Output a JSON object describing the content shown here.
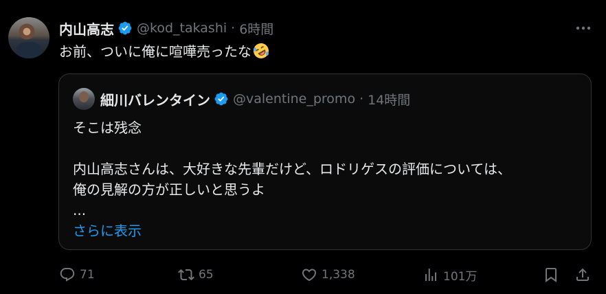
{
  "tweet": {
    "author_name": "内山高志",
    "handle": "@kod_takashi",
    "separator": "·",
    "time": "6時間",
    "text": "お前、ついに俺に喧嘩売ったな",
    "emoji": "rolling-on-floor-laughing-emoji"
  },
  "quote": {
    "author_name": "細川バレンタイン",
    "handle": "@valentine_promo",
    "separator": "·",
    "time": "14時間",
    "lines": [
      "そこは残念",
      "",
      "内山高志さんは、大好きな先輩だけど、ロドリゲスの評価については、",
      "俺の見解の方が正しいと思うよ",
      "..."
    ],
    "show_more": "さらに表示"
  },
  "actions": {
    "reply_count": "71",
    "retweet_count": "65",
    "like_count": "1,338",
    "views_count": "101万"
  },
  "colors": {
    "background": "#000000",
    "text": "#e7e9ea",
    "muted": "#71767b",
    "accent": "#1d9bf0",
    "border": "#2f3336"
  },
  "icons": [
    "verified-badge-icon",
    "more-icon",
    "reply-icon",
    "retweet-icon",
    "like-icon",
    "views-icon",
    "bookmark-icon",
    "share-icon"
  ]
}
